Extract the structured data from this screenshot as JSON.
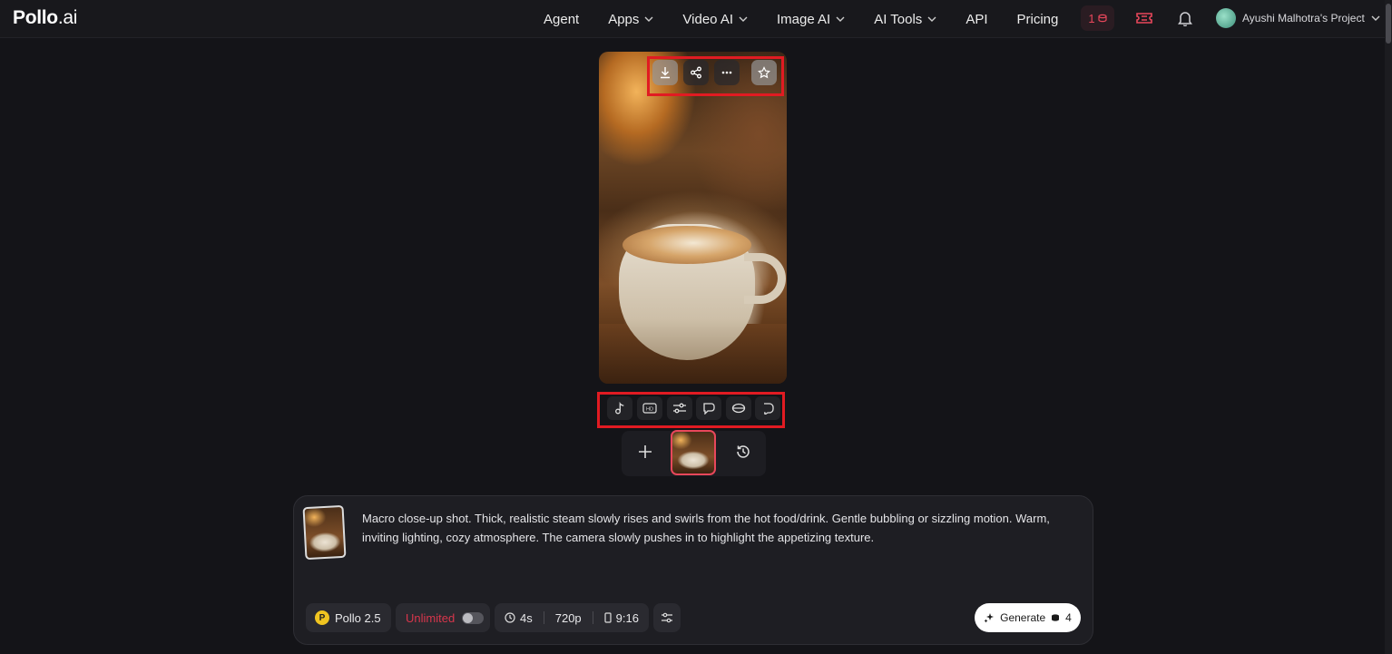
{
  "header": {
    "logo_main": "Pollo",
    "logo_suffix": ".ai",
    "nav": [
      {
        "label": "Agent",
        "dropdown": false
      },
      {
        "label": "Apps",
        "dropdown": true
      },
      {
        "label": "Video AI",
        "dropdown": true
      },
      {
        "label": "Image AI",
        "dropdown": true
      },
      {
        "label": "AI Tools",
        "dropdown": true
      },
      {
        "label": "API",
        "dropdown": false
      },
      {
        "label": "Pricing",
        "dropdown": false
      }
    ],
    "credits": "1",
    "project_name": "Ayushi Malhotra's Project"
  },
  "preview": {
    "actions": [
      "download-icon",
      "share-icon",
      "more-icon",
      "favorite-icon"
    ]
  },
  "tools": [
    "music-note-icon",
    "hd-upscale-icon",
    "adjust-icon",
    "lip-sync-icon",
    "loop-icon",
    "extend-icon"
  ],
  "prompt": {
    "text": "Macro close-up shot. Thick, realistic steam slowly rises and swirls from the hot food/drink. Gentle bubbling or sizzling motion. Warm, inviting lighting, cozy atmosphere. The camera slowly pushes in to highlight the appetizing texture."
  },
  "controls": {
    "model": "Pollo 2.5",
    "model_logo": "P",
    "unlimited_label": "Unlimited",
    "unlimited_on": false,
    "duration": "4s",
    "resolution": "720p",
    "aspect_ratio": "9:16",
    "generate_label": "Generate",
    "generate_cost": "4"
  },
  "colors": {
    "accent_red": "#e8475b",
    "highlight_box": "#e11b22",
    "background": "#141418"
  }
}
